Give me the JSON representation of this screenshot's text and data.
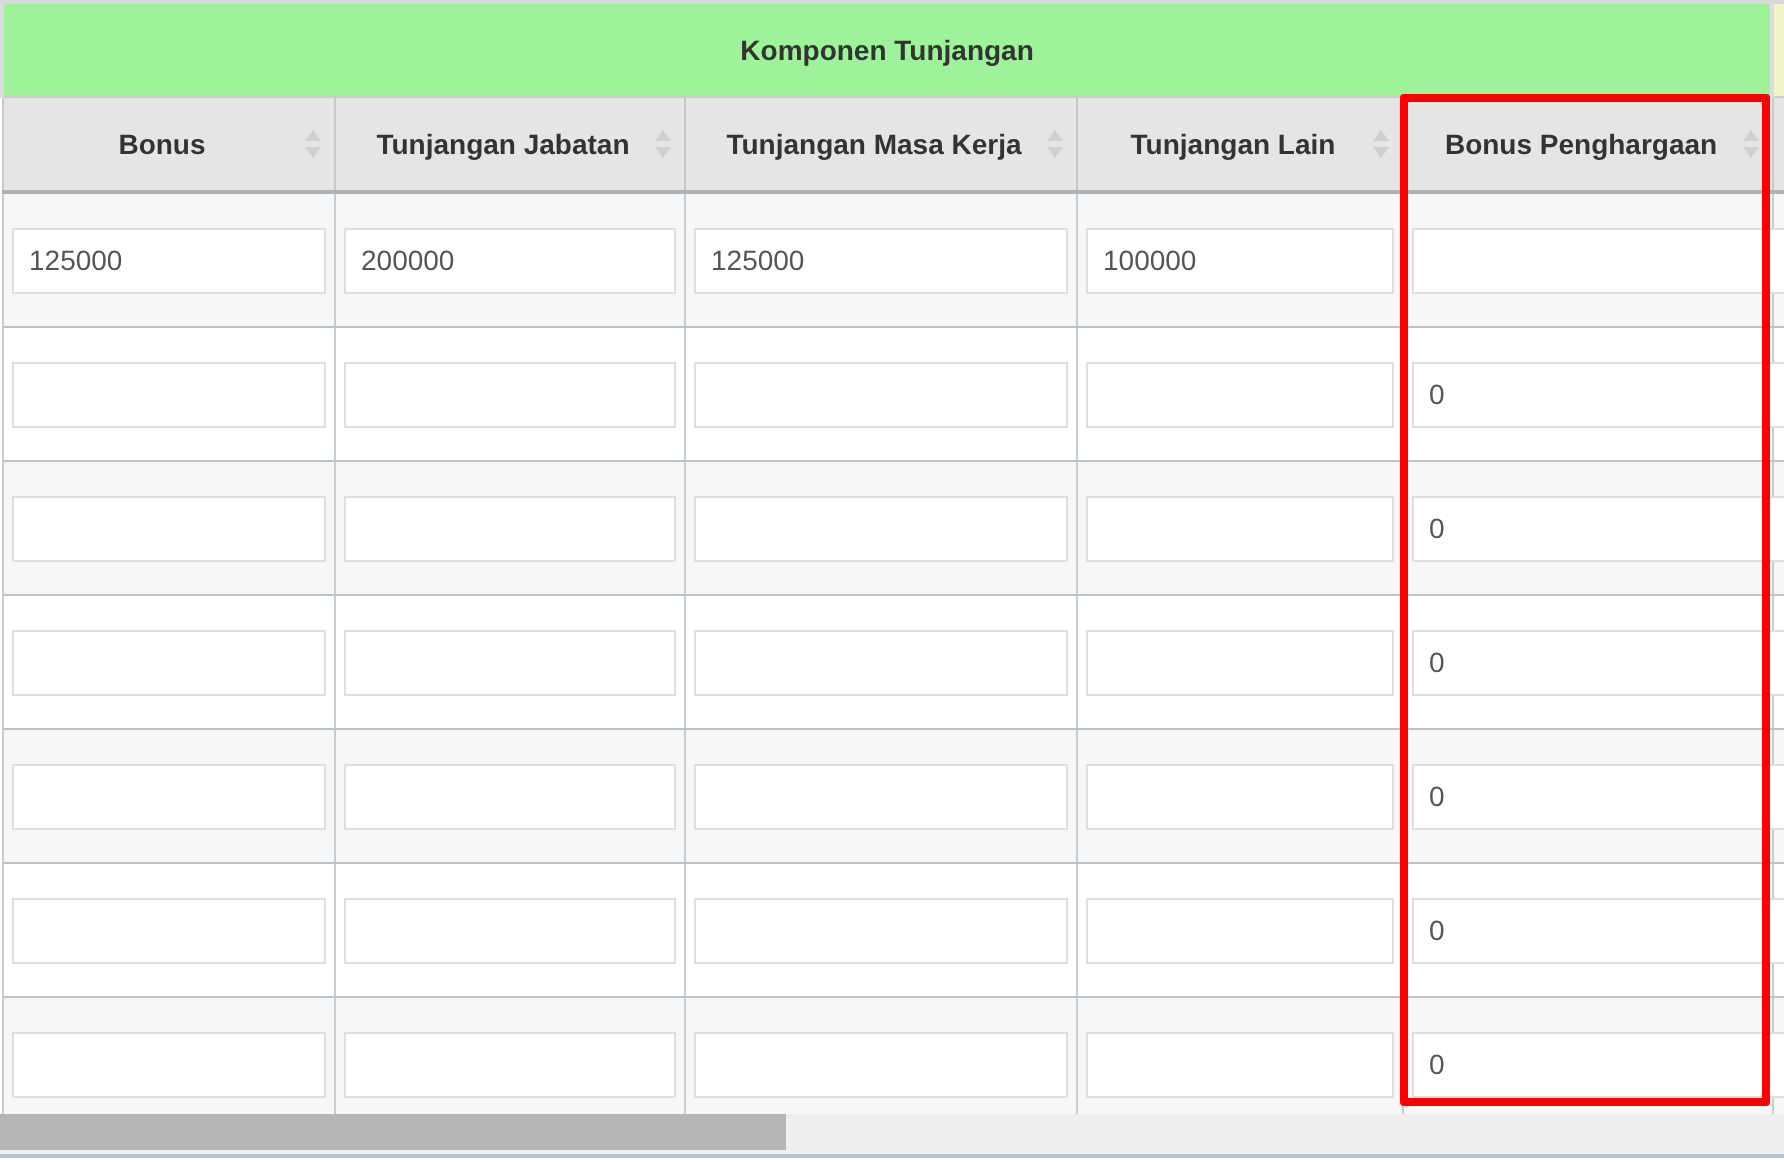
{
  "table": {
    "group_header": "Komponen Tunjangan",
    "columns": [
      {
        "label": "Bonus",
        "highlighted": false
      },
      {
        "label": "Tunjangan Jabatan",
        "highlighted": false
      },
      {
        "label": "Tunjangan Masa Kerja",
        "highlighted": false
      },
      {
        "label": "Tunjangan Lain",
        "highlighted": false
      },
      {
        "label": "Bonus Penghargaan",
        "highlighted": true
      }
    ],
    "rows": [
      {
        "cells": [
          {
            "value": "125000"
          },
          {
            "value": "200000"
          },
          {
            "value": "125000"
          },
          {
            "value": "100000"
          },
          {}
        ]
      },
      {
        "cells": [
          {},
          {},
          {},
          {},
          {
            "value": "0"
          }
        ]
      },
      {
        "cells": [
          {},
          {},
          {},
          {},
          {
            "value": "0"
          }
        ]
      },
      {
        "cells": [
          {},
          {},
          {},
          {},
          {
            "value": "0"
          }
        ]
      },
      {
        "cells": [
          {},
          {},
          {},
          {},
          {
            "value": "0"
          }
        ]
      },
      {
        "cells": [
          {},
          {},
          {},
          {},
          {
            "value": "0"
          }
        ]
      },
      {
        "cells": [
          {},
          {},
          {},
          {},
          {
            "value": "0"
          }
        ]
      }
    ]
  }
}
